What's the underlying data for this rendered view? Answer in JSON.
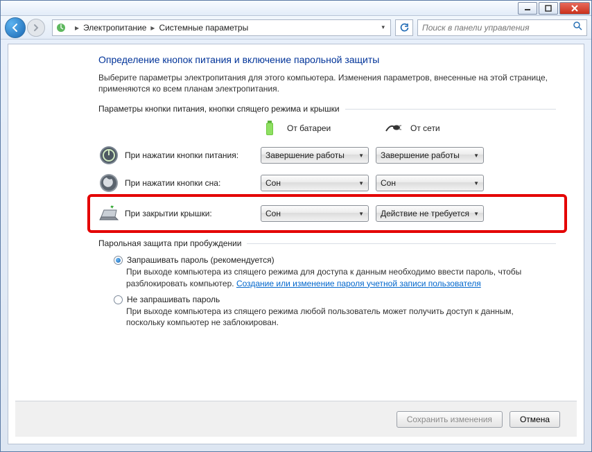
{
  "breadcrumb": {
    "item1": "Электропитание",
    "item2": "Системные параметры"
  },
  "search": {
    "placeholder": "Поиск в панели управления"
  },
  "heading": "Определение кнопок питания и включение парольной защиты",
  "intro": "Выберите параметры электропитания для этого компьютера. Изменения параметров, внесенные на этой странице, применяются ко всем планам электропитания.",
  "group1": {
    "title": "Параметры кнопки питания, кнопки спящего режима и крышки",
    "col_battery": "От батареи",
    "col_ac": "От сети",
    "rows": {
      "power": {
        "label": "При нажатии кнопки питания:",
        "battery": "Завершение работы",
        "ac": "Завершение работы"
      },
      "sleep": {
        "label": "При нажатии кнопки сна:",
        "battery": "Сон",
        "ac": "Сон"
      },
      "lid": {
        "label": "При закрытии крышки:",
        "battery": "Сон",
        "ac": "Действие не требуется"
      }
    }
  },
  "group2": {
    "title": "Парольная защита при пробуждении",
    "opt_require": "Запрашивать пароль (рекомендуется)",
    "opt_require_desc_a": "При выходе компьютера из спящего режима для доступа к данным необходимо ввести пароль, чтобы разблокировать компьютер. ",
    "opt_require_link": "Создание или изменение пароля учетной записи пользователя",
    "opt_norequire": "Не запрашивать пароль",
    "opt_norequire_desc": "При выходе компьютера из спящего режима любой пользователь может получить доступ к данным, поскольку компьютер не заблокирован."
  },
  "footer": {
    "save": "Сохранить изменения",
    "cancel": "Отмена"
  }
}
